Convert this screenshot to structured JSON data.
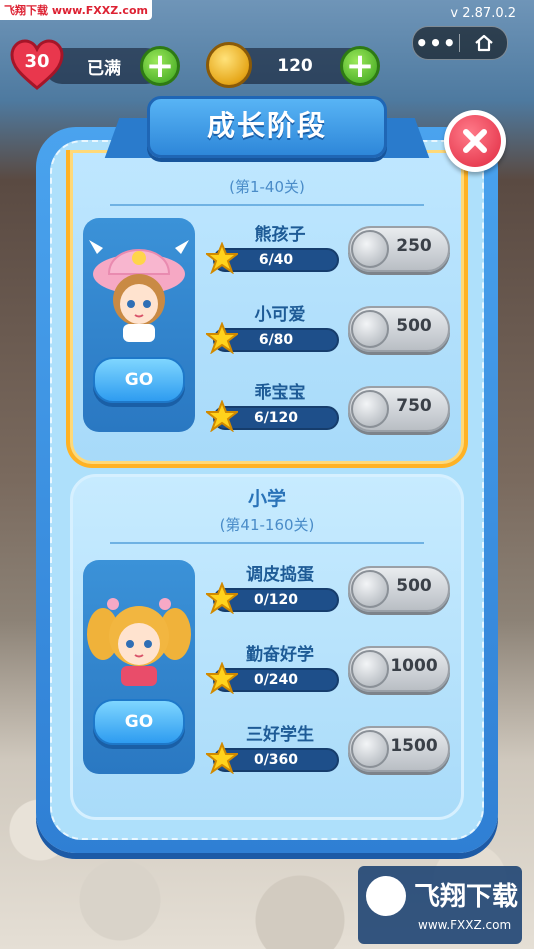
{
  "watermark": {
    "top_left": "飞翔下载 www.FXXZ.com",
    "logo_title": "飞翔下载",
    "logo_url": "www.FXXZ.com"
  },
  "header": {
    "version": "v 2.87.0.2",
    "lives_count": "30",
    "lives_status": "已满",
    "coins": "120"
  },
  "capsule": {
    "menu_icon": "more-dots-icon",
    "home_icon": "home-icon"
  },
  "panel": {
    "title": "成长阶段",
    "close_icon": "close-x-icon"
  },
  "stages": [
    {
      "name": "",
      "levels": "(第1-40关)",
      "go_label": "GO",
      "highlighted": true,
      "tasks": [
        {
          "name": "熊孩子",
          "progress": "6/40",
          "reward": "250"
        },
        {
          "name": "小可爱",
          "progress": "6/80",
          "reward": "500"
        },
        {
          "name": "乖宝宝",
          "progress": "6/120",
          "reward": "750"
        }
      ]
    },
    {
      "name": "小学",
      "levels": "(第41-160关)",
      "go_label": "GO",
      "highlighted": false,
      "tasks": [
        {
          "name": "调皮捣蛋",
          "progress": "0/120",
          "reward": "500"
        },
        {
          "name": "勤奋好学",
          "progress": "0/240",
          "reward": "1000"
        },
        {
          "name": "三好学生",
          "progress": "0/360",
          "reward": "1500"
        }
      ]
    }
  ],
  "colors": {
    "accent_blue": "#2f7fd4",
    "highlight_gold": "#ffb224",
    "plus_green": "#39a21c",
    "close_red": "#e0283f"
  }
}
